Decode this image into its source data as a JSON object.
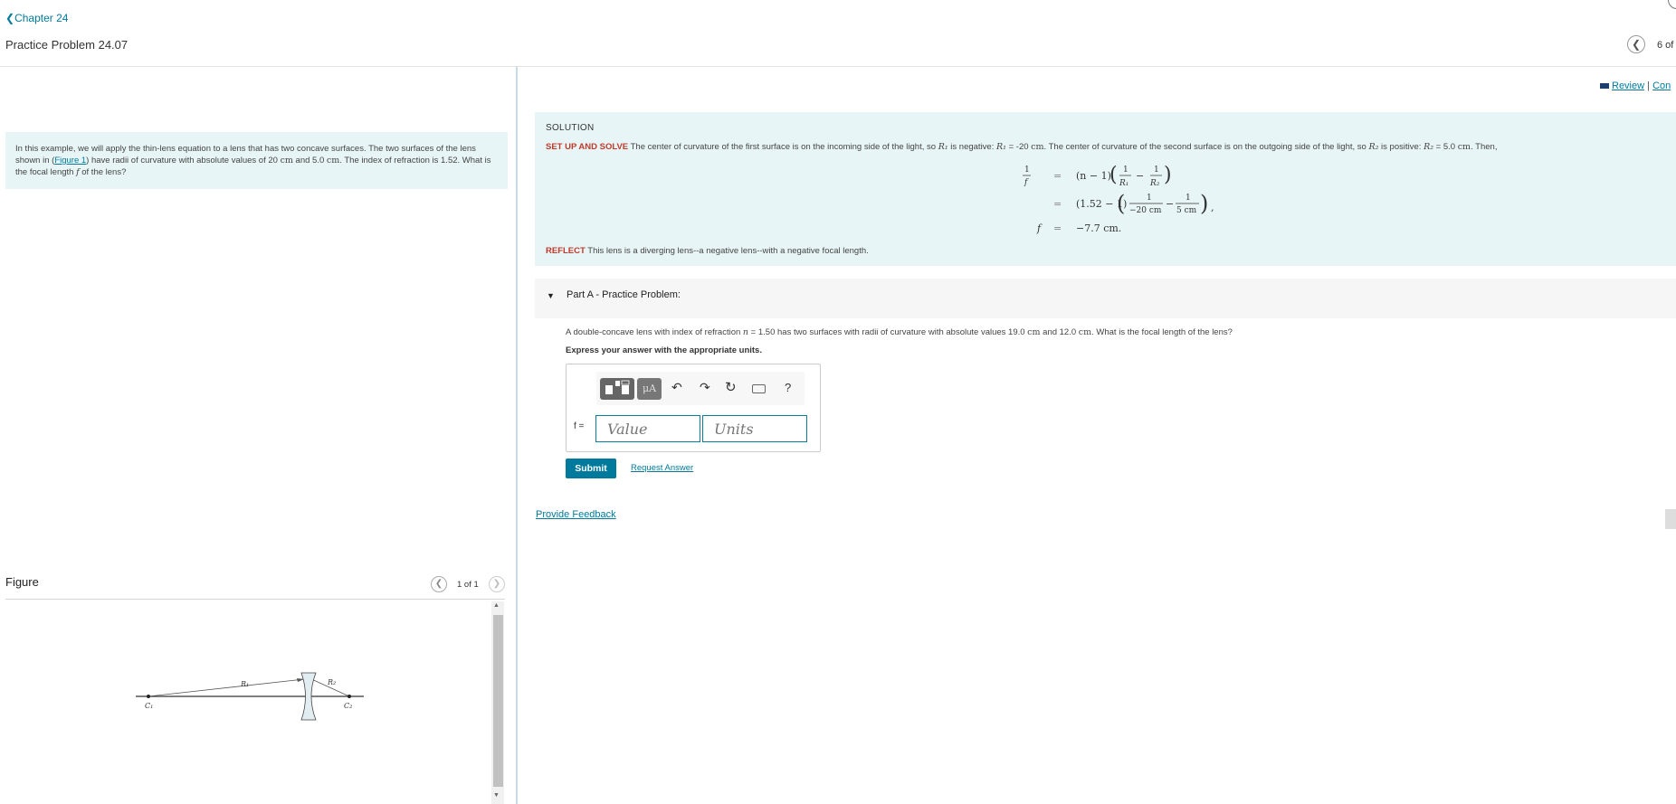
{
  "header": {
    "chapter_link": "Chapter 24",
    "page_title": "Practice Problem 24.07",
    "pager_count": "6 of",
    "review_label": "Review",
    "review_sep": "|",
    "review_trail": "Con"
  },
  "problem": {
    "text_1": "In this example, we will apply the thin-lens equation to a lens that has two concave surfaces. The two surfaces of the lens shown in (",
    "figure_link": "Figure 1",
    "text_2": ") have radii of curvature with absolute values of 20 ",
    "unit_cm": "cm",
    "text_3": " and 5.0 ",
    "text_4": ". The index of refraction is 1.52. What is the focal length ",
    "f_symbol": "f",
    "text_5": " of the lens?"
  },
  "figure": {
    "title": "Figure",
    "count": "1 of 1",
    "labels": {
      "r1": "R₁",
      "r2": "R₂",
      "c1": "C₁",
      "c2": "C₂"
    }
  },
  "solution": {
    "label": "SOLUTION",
    "setup_label": "SET UP AND SOLVE",
    "setup_a": " The center of curvature of the first surface is on the incoming side of the light, so ",
    "r1": "R₁",
    "setup_b": " is negative: ",
    "setup_c": " = -20 ",
    "cm": "cm",
    "setup_d": ". The center of curvature of the second surface is on the outgoing side of the light, so ",
    "r2": "R₂",
    "setup_e": " is positive: ",
    "setup_f": " = 5.0 ",
    "setup_g": ". Then,",
    "eq": {
      "one": "1",
      "f": "f",
      "eq_sign": "=",
      "n_minus_1": "(n − 1)",
      "r1_den": "R₁",
      "r2_den": "R₂",
      "minus": "−",
      "nval": "(1.52 − 1)",
      "den1": "−20 cm",
      "den2": "5 cm",
      "comma": ",",
      "result": "−7.7 cm."
    },
    "reflect_label": "REFLECT",
    "reflect_text": " This lens is a diverging lens--a negative lens--with a negative focal length."
  },
  "part_a": {
    "arrow": "▼",
    "title": "Part A - Practice Problem:",
    "question_a": "A double-concave lens with index of refraction ",
    "n": "n",
    "question_b": " = 1.50 has two surfaces with radii of curvature with absolute values 19.0 ",
    "cm": "cm",
    "question_c": " and 12.0 ",
    "question_d": ". What is the focal length of the lens?",
    "instruction": "Express your answer with the appropriate units.",
    "f_label": "f =",
    "value_placeholder": "Value",
    "units_placeholder": "Units",
    "units_button": "μA",
    "help_label": "?",
    "submit_label": "Submit",
    "request_answer": "Request Answer"
  },
  "feedback": {
    "label": "Provide Feedback"
  }
}
